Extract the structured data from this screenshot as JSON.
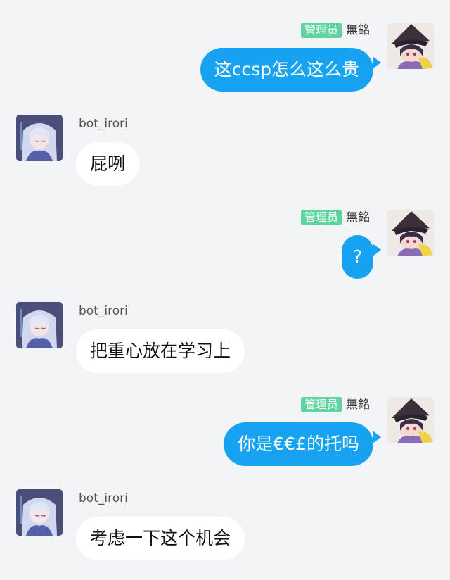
{
  "self": {
    "badge": "管理员",
    "name": "無銘"
  },
  "bot": {
    "name": "bot_irori"
  },
  "messages": [
    {
      "from": "self",
      "text": "这ccsp怎么这么贵"
    },
    {
      "from": "bot",
      "text": "屁咧"
    },
    {
      "from": "self",
      "text": "?"
    },
    {
      "from": "bot",
      "text": "把重心放在学习上"
    },
    {
      "from": "self",
      "text": "你是€€£的托吗"
    },
    {
      "from": "bot",
      "text": "考虑一下这个机会"
    }
  ],
  "colors": {
    "background": "#f3f4f8",
    "outgoing_bubble": "#17a3f2",
    "incoming_bubble": "#ffffff",
    "badge": "#5fd3a0"
  },
  "icons": {
    "self_avatar": "witch-hat-avatar-icon",
    "bot_avatar": "anime-girl-avatar-icon"
  }
}
